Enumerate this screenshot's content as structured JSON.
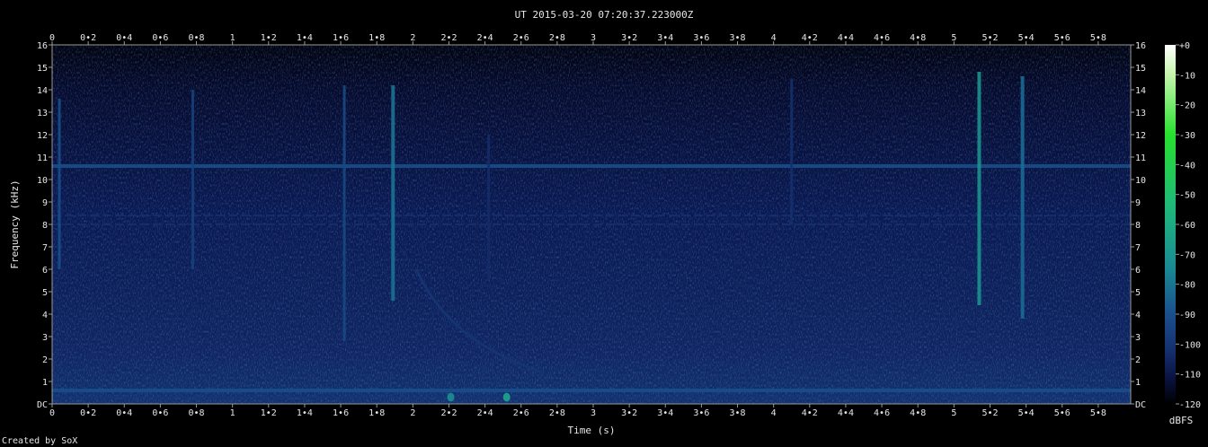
{
  "title": "UT 2015-03-20 07:20:37.223000Z",
  "credit": "Created by SoX",
  "colors": {
    "background": "#000000",
    "frame": "#9a9a9a",
    "tick_text": "#e6e6e6",
    "colormap": [
      "#ffffff",
      "#b8f0a0",
      "#27e02e",
      "#1fbf6a",
      "#1b9a8c",
      "#1a5f96",
      "#14306e",
      "#0b1446",
      "#000000"
    ]
  },
  "chart_data": {
    "type": "heatmap",
    "title": "UT 2015-03-20 07:20:37.223000Z",
    "xlabel": "Time (s)",
    "ylabel": "Frequency (kHz)",
    "colorbar_label": "dBFS",
    "xlim": [
      0,
      5.98
    ],
    "ylim": [
      0,
      16
    ],
    "x_ticks": [
      "0",
      "0.2",
      "0.4",
      "0.6",
      "0.8",
      "1",
      "1.2",
      "1.4",
      "1.6",
      "1.8",
      "2",
      "2.2",
      "2.4",
      "2.6",
      "2.8",
      "3",
      "3.2",
      "3.4",
      "3.6",
      "3.8",
      "4",
      "4.2",
      "4.4",
      "4.6",
      "4.8",
      "5",
      "5.2",
      "5.4",
      "5.6",
      "5.8"
    ],
    "y_ticks": [
      "DC",
      "1",
      "2",
      "3",
      "4",
      "5",
      "6",
      "7",
      "8",
      "9",
      "10",
      "11",
      "12",
      "13",
      "14",
      "15",
      "16"
    ],
    "colorbar_ticks": [
      "+0",
      "-10",
      "-20",
      "-30",
      "-40",
      "-50",
      "-60",
      "-70",
      "-80",
      "-90",
      "-100",
      "-110",
      "-120"
    ],
    "colorbar_range": [
      -120,
      0
    ],
    "noise_floor_dbfs": -100,
    "steady_tones": [
      {
        "freq_khz": 10.6,
        "level_dbfs": -80
      },
      {
        "freq_khz": 8.4,
        "level_dbfs": -90
      },
      {
        "freq_khz": 8.0,
        "level_dbfs": -90
      },
      {
        "freq_khz": 0.6,
        "level_dbfs": -80
      },
      {
        "freq_khz": 0.3,
        "level_dbfs": -88
      }
    ],
    "impulses": [
      {
        "t": 0.04,
        "f_low": 6.0,
        "f_high": 13.6,
        "level_dbfs": -80
      },
      {
        "t": 0.78,
        "f_low": 6.0,
        "f_high": 14.0,
        "level_dbfs": -85
      },
      {
        "t": 1.62,
        "f_low": 2.8,
        "f_high": 14.2,
        "level_dbfs": -82
      },
      {
        "t": 1.89,
        "f_low": 4.6,
        "f_high": 14.2,
        "level_dbfs": -70
      },
      {
        "t": 2.42,
        "f_low": 5.5,
        "f_high": 12.0,
        "level_dbfs": -92
      },
      {
        "t": 4.1,
        "f_low": 8.0,
        "f_high": 14.5,
        "level_dbfs": -90
      },
      {
        "t": 5.14,
        "f_low": 4.4,
        "f_high": 14.8,
        "level_dbfs": -62
      },
      {
        "t": 5.38,
        "f_low": 3.8,
        "f_high": 14.6,
        "level_dbfs": -72
      }
    ],
    "whistler": {
      "t_start": 2.02,
      "f_start_khz": 6.0,
      "t_end": 2.72,
      "f_end_khz": 1.4,
      "level_dbfs": -88
    },
    "spots": [
      {
        "t": 2.21,
        "f_khz": 0.3,
        "level_dbfs": -65
      },
      {
        "t": 2.52,
        "f_khz": 0.3,
        "level_dbfs": -60
      }
    ]
  }
}
